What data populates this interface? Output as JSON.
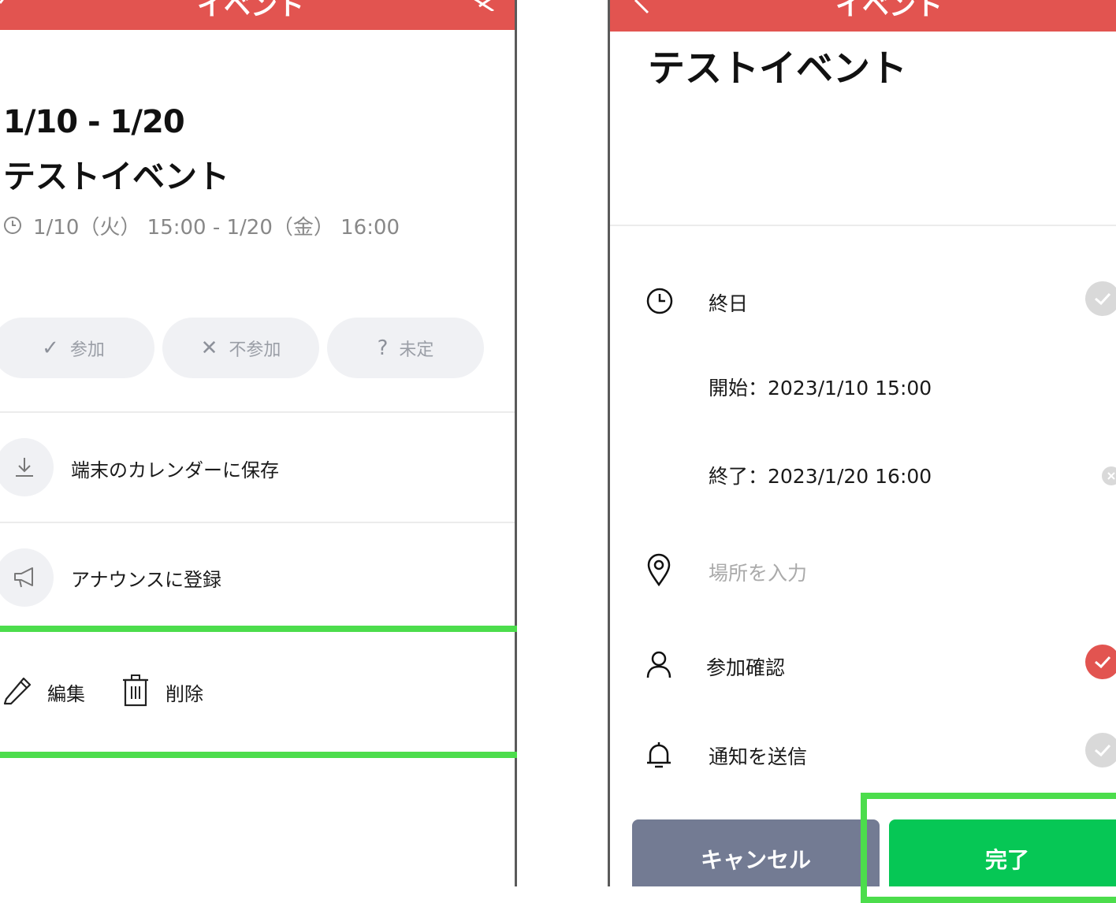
{
  "left": {
    "header_title": "イベント",
    "event_date_range": "1/10 - 1/20",
    "event_title": "テストイベント",
    "time_range": "1/10（火） 15:00 - 1/20（金） 16:00",
    "rsvp": {
      "attend": "参加",
      "decline": "不参加",
      "undecided": "未定"
    },
    "save_to_calendar": "端末のカレンダーに保存",
    "register_announcement": "アナウンスに登録",
    "edit": "編集",
    "delete": "削除"
  },
  "right": {
    "header_title": "イベント",
    "event_title": "テストイベント",
    "all_day_label": "終日",
    "start": "開始：2023/1/10 15:00",
    "end": "終了：2023/1/20 16:00",
    "location_placeholder": "場所を入力",
    "attendance_check": "参加確認",
    "send_notification": "通知を送信",
    "cancel": "キャンセル",
    "done": "完了"
  },
  "colors": {
    "header": "#e25450",
    "highlight": "#4cdd4c",
    "done_button": "#06c755",
    "cancel_button": "#737b93",
    "check_on": "#e25450",
    "check_off": "#d9d9d9"
  }
}
